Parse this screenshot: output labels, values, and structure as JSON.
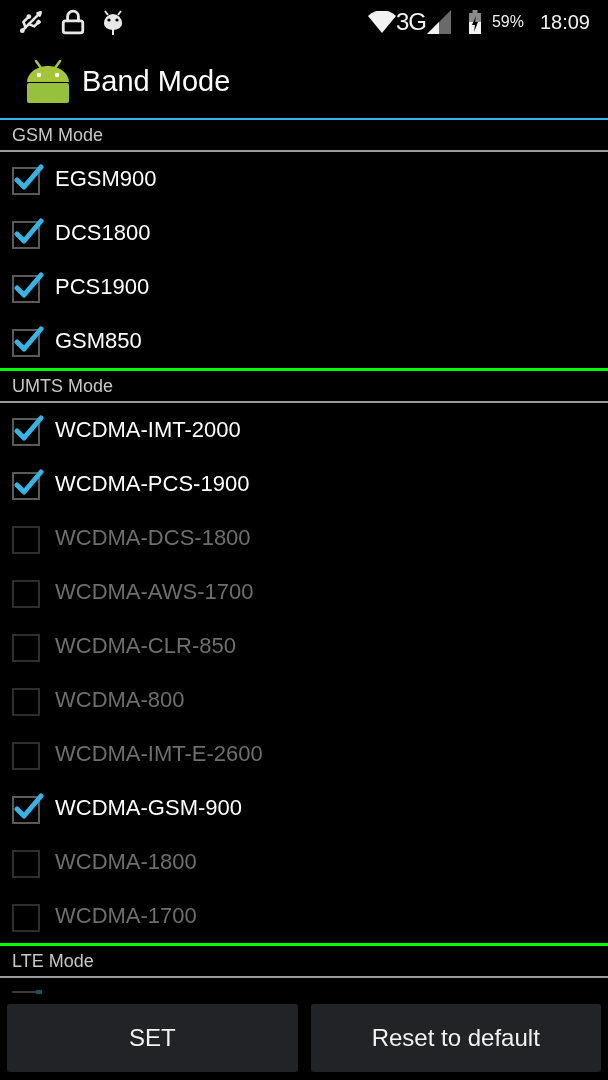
{
  "status_bar": {
    "network": "3G",
    "battery": "59%",
    "time": "18:09"
  },
  "app_bar": {
    "title": "Band Mode"
  },
  "sections": [
    {
      "title": "GSM Mode",
      "bands": [
        {
          "label": "EGSM900",
          "checked": true,
          "disabled": false
        },
        {
          "label": "DCS1800",
          "checked": true,
          "disabled": false
        },
        {
          "label": "PCS1900",
          "checked": true,
          "disabled": false
        },
        {
          "label": "GSM850",
          "checked": true,
          "disabled": false
        }
      ]
    },
    {
      "title": "UMTS Mode",
      "bands": [
        {
          "label": "WCDMA-IMT-2000",
          "checked": true,
          "disabled": false
        },
        {
          "label": "WCDMA-PCS-1900",
          "checked": true,
          "disabled": false
        },
        {
          "label": "WCDMA-DCS-1800",
          "checked": false,
          "disabled": true
        },
        {
          "label": "WCDMA-AWS-1700",
          "checked": false,
          "disabled": true
        },
        {
          "label": "WCDMA-CLR-850",
          "checked": false,
          "disabled": true
        },
        {
          "label": "WCDMA-800",
          "checked": false,
          "disabled": true
        },
        {
          "label": "WCDMA-IMT-E-2600",
          "checked": false,
          "disabled": true
        },
        {
          "label": "WCDMA-GSM-900",
          "checked": true,
          "disabled": false
        },
        {
          "label": "WCDMA-1800",
          "checked": false,
          "disabled": true
        },
        {
          "label": "WCDMA-1700",
          "checked": false,
          "disabled": true
        }
      ]
    },
    {
      "title": "LTE Mode"
    }
  ],
  "buttons": [
    {
      "label": "SET"
    },
    {
      "label": "Reset to default"
    }
  ]
}
